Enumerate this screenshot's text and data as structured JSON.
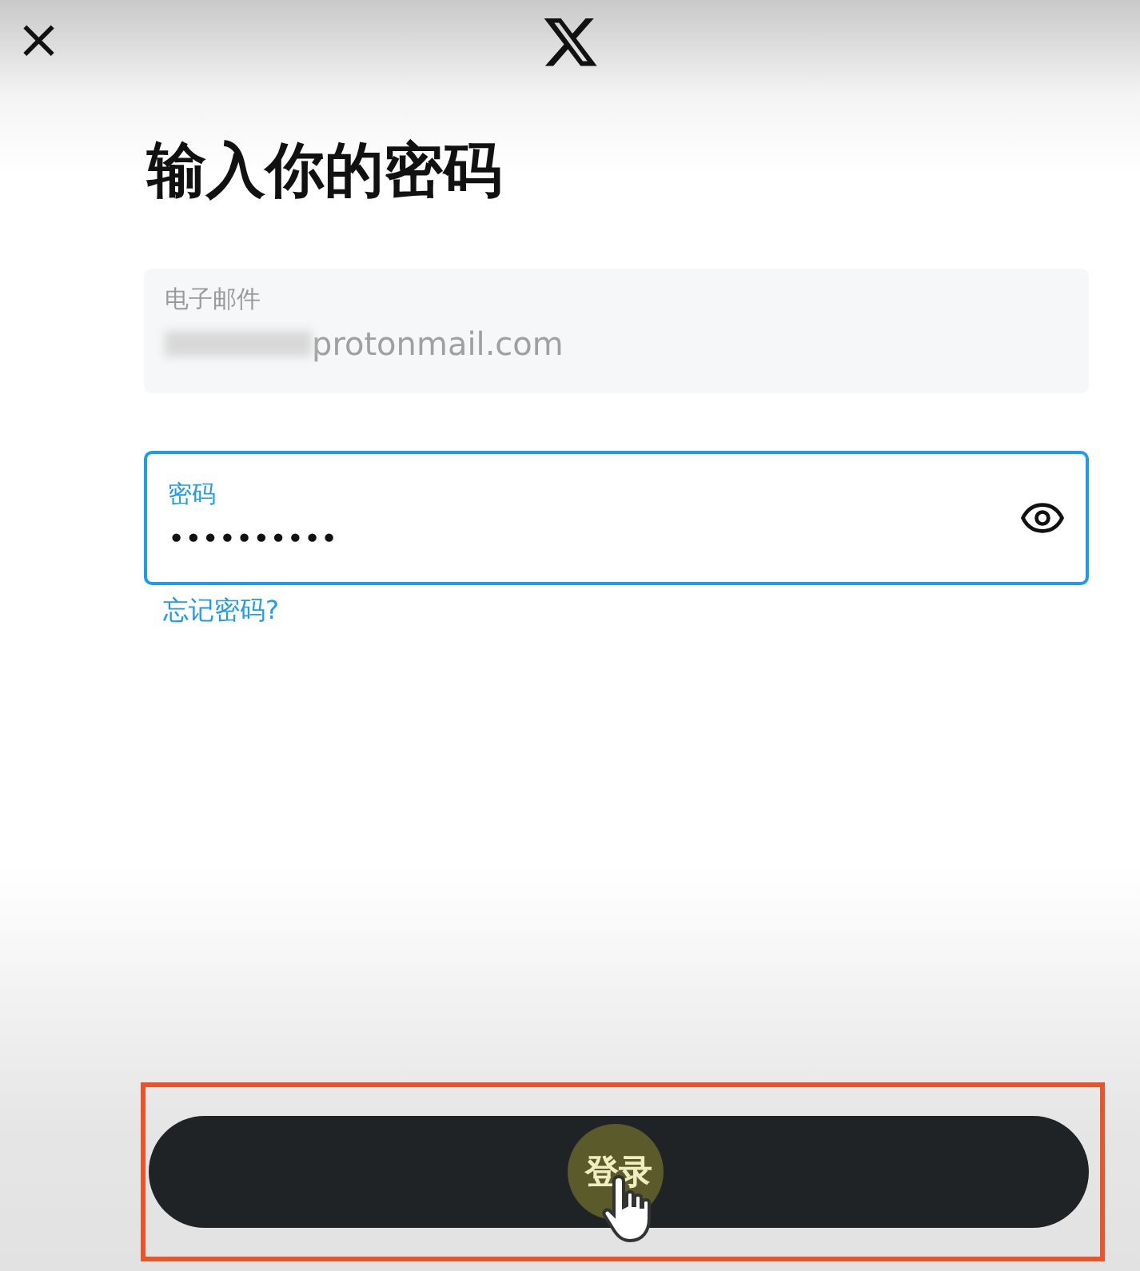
{
  "header": {
    "close": "×"
  },
  "title": "输入你的密码",
  "email_field": {
    "label": "电子邮件",
    "value": "protonmail.com",
    "disabled": true,
    "redacted": true
  },
  "password_field": {
    "label": "密码",
    "value": "••••••••••",
    "focused": true
  },
  "forgot_link": "忘记密码?",
  "login_button": {
    "label": "登录",
    "highlighted": true,
    "pressed": true
  }
}
